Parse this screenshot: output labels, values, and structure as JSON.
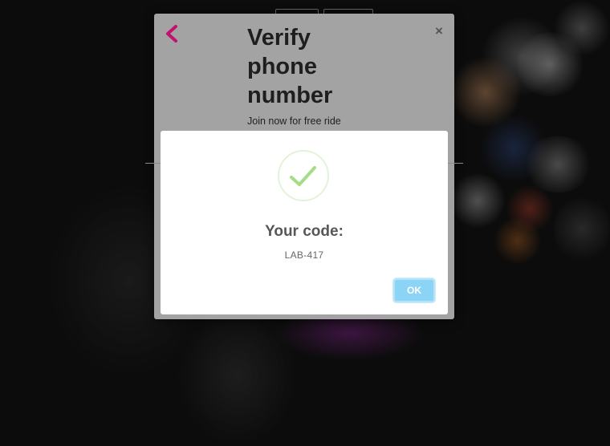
{
  "modal": {
    "title": "Verify phone number",
    "subtitle": "Join now for free ride",
    "back_icon": "chevron-left-icon",
    "close_label": "×"
  },
  "alert": {
    "icon": "checkmark-icon",
    "title": "Your code:",
    "code": "LAB-417",
    "ok_label": "OK"
  },
  "colors": {
    "back_accent": "#c2126e",
    "success_check": "#a5dc86",
    "ok_button": "#8cd4f5",
    "backdrop": "#141414"
  }
}
